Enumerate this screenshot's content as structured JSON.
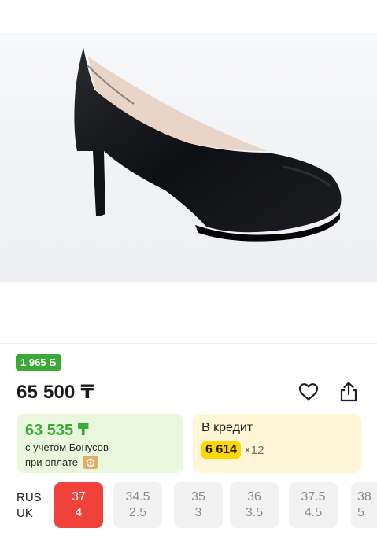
{
  "product": {
    "image_alt": "black leather platform pump",
    "bonus_badge": "1 965 Б",
    "price": "65 500 ₸"
  },
  "actions": {
    "favorite_icon": "heart-icon",
    "share_icon": "share-icon"
  },
  "bonus_card": {
    "amount": "63 535 ₸",
    "line1": "с учетом Бонусов",
    "line2": "при оплате",
    "coin_icon": "bonus-coin-icon",
    "accent": "#3aa935",
    "background": "#e9f7dc"
  },
  "credit_card": {
    "title": "В кредит",
    "monthly": "6 614",
    "term": "×12",
    "highlight": "#ffd600",
    "background": "#fff6d6"
  },
  "sizes": {
    "label_top": "RUS",
    "label_bottom": "UK",
    "selected_color": "#f1413b",
    "options": [
      {
        "rus": "37",
        "uk": "4",
        "selected": true
      },
      {
        "rus": "34.5",
        "uk": "2.5",
        "selected": false
      },
      {
        "rus": "35",
        "uk": "3",
        "selected": false
      },
      {
        "rus": "36",
        "uk": "3.5",
        "selected": false
      },
      {
        "rus": "37.5",
        "uk": "4.5",
        "selected": false
      },
      {
        "rus": "38",
        "uk": "5",
        "selected": false
      }
    ]
  }
}
